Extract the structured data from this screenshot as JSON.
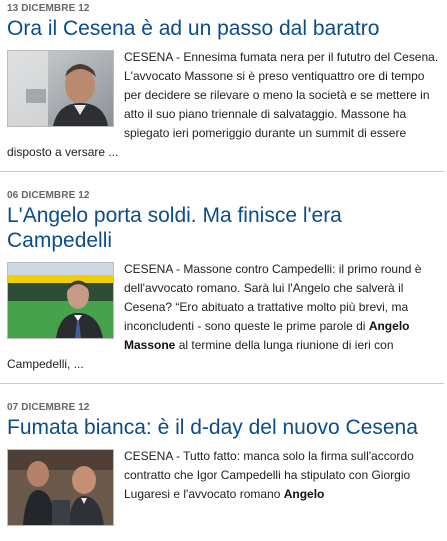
{
  "articles": [
    {
      "date": "13 DICEMBRE 12",
      "title": "Ora il Cesena è ad un passo dal baratro",
      "image_alt": "Massone photo",
      "text": "CESENA - Ennesima fumata nera per il fututro del Cesena. L'avvocato Massone si è preso ventiquattro ore di tempo per decidere se rilevare o meno la società e se mettere in atto il suo piano triennale di salvataggio. Massone ha spiegato ieri pomeriggio durante un summit di essere disposto a versare ..."
    },
    {
      "date": "06 DICEMBRE 12",
      "title": "L'Angelo porta soldi. Ma finisce l'era Campedelli",
      "image_alt": "Stadium photo",
      "text_before": "CESENA - Massone contro Campedelli: il primo round è dell'avvocato romano. Sarà lui l'Angelo che salverà il Cesena? “Ero abituato a trattative molto più brevi, ma inconcludenti - sono queste le prime parole di ",
      "text_bold": "Angelo Massone",
      "text_after": " al termine della lunga riunione di ieri con Campedelli, ..."
    },
    {
      "date": "07 DICEMBRE 12",
      "title": "Fumata bianca: è il d-day del nuovo Cesena",
      "image_alt": "Group photo",
      "text_before": "CESENA - Tutto fatto: manca solo la firma sull'accordo contratto che Igor Campedelli ha stipulato con Giorgio Lugaresi e l'avvocato romano ",
      "text_bold": "Angelo"
    }
  ],
  "colors": {
    "title": "#0b4c8a",
    "date": "#666666",
    "body": "#222222",
    "divider": "#cccccc"
  }
}
